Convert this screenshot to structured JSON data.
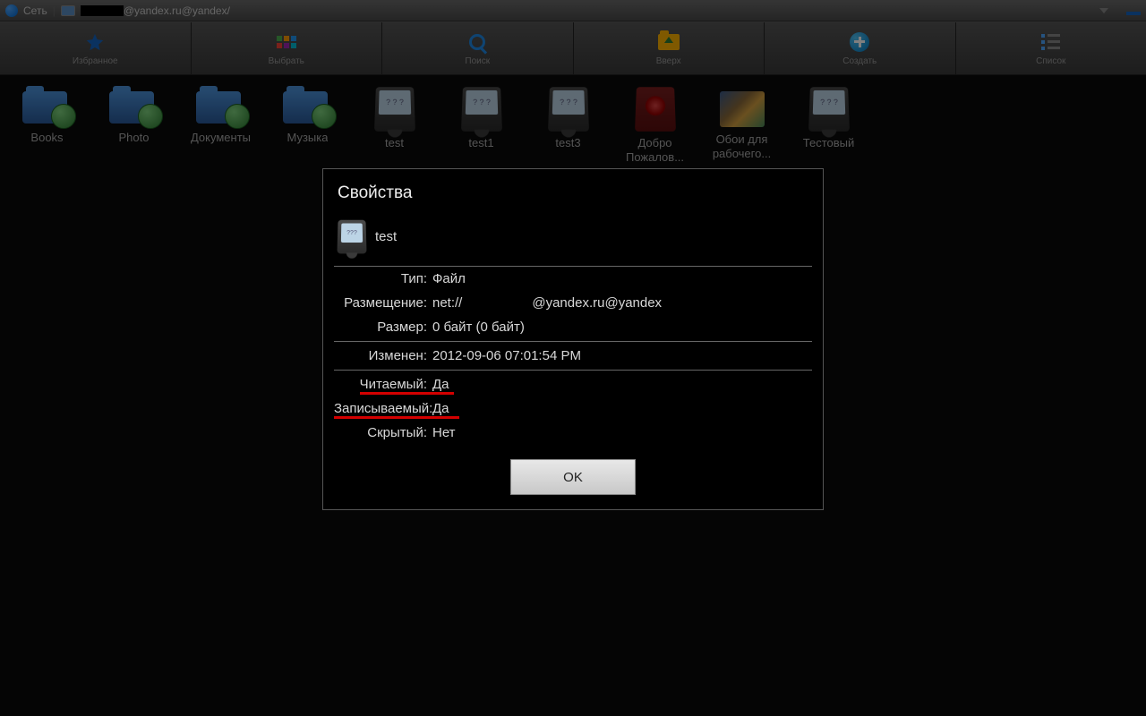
{
  "addressBar": {
    "network": "Сеть",
    "path_suffix": "@yandex.ru@yandex/"
  },
  "toolbar": [
    {
      "label": "Избранное"
    },
    {
      "label": "Выбрать"
    },
    {
      "label": "Поиск"
    },
    {
      "label": "Вверх"
    },
    {
      "label": "Создать"
    },
    {
      "label": "Список"
    }
  ],
  "files": [
    {
      "label": "Books",
      "type": "netfolder"
    },
    {
      "label": "Photo",
      "type": "netfolder"
    },
    {
      "label": "Документы",
      "type": "netfolder"
    },
    {
      "label": "Музыка",
      "type": "netfolder"
    },
    {
      "label": "test",
      "type": "file"
    },
    {
      "label": "test1",
      "type": "file"
    },
    {
      "label": "test3",
      "type": "file"
    },
    {
      "label": "Добро Пожалов...",
      "type": "pdf"
    },
    {
      "label": "Обои для рабочего...",
      "type": "image"
    },
    {
      "label": "Тестовый",
      "type": "file"
    }
  ],
  "dialog": {
    "title": "Свойства",
    "filename": "test",
    "labels": {
      "type": "Тип:",
      "location": "Размещение:",
      "size": "Размер:",
      "modified": "Изменен:",
      "readable": "Читаемый:",
      "writable": "Записываемый:",
      "hidden": "Скрытый:"
    },
    "values": {
      "type": "Файл",
      "location_prefix": "net://",
      "location_suffix": "@yandex.ru@yandex",
      "size": "0 байт (0 байт)",
      "modified": "2012-09-06 07:01:54 PM",
      "readable": "Да",
      "writable": "Да",
      "hidden": "Нет"
    },
    "ok": "OK"
  }
}
